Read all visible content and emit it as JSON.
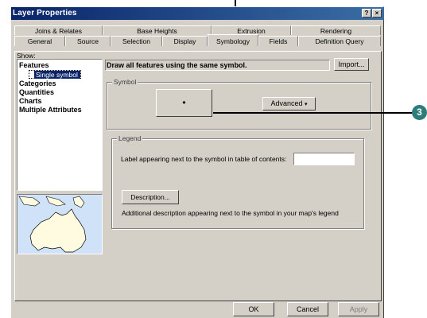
{
  "window": {
    "title": "Layer Properties",
    "help_label": "?",
    "close_label": "×"
  },
  "tabs_back": [
    "Joins & Relates",
    "Base Heights",
    "Extrusion",
    "Rendering"
  ],
  "tabs_front": [
    "General",
    "Source",
    "Selection",
    "Display",
    "Symbology",
    "Fields",
    "Definition Query"
  ],
  "active_tab": "Symbology",
  "show": {
    "label": "Show:",
    "items": [
      "Features",
      "Categories",
      "Quantities",
      "Charts",
      "Multiple Attributes"
    ],
    "selected_sub": "Single symbol"
  },
  "headline": "Draw all features using the same symbol.",
  "import_label": "Import...",
  "symbol": {
    "group_label": "Symbol",
    "preview": "•",
    "advanced_label": "Advanced"
  },
  "legend": {
    "group_label": "Legend",
    "label_text": "Label appearing next to the symbol in table of contents:",
    "label_value": "",
    "description_button": "Description...",
    "description_text": "Additional description appearing next to the symbol in your map's legend"
  },
  "footer": {
    "ok": "OK",
    "cancel": "Cancel",
    "apply": "Apply"
  },
  "callout_number": "3"
}
